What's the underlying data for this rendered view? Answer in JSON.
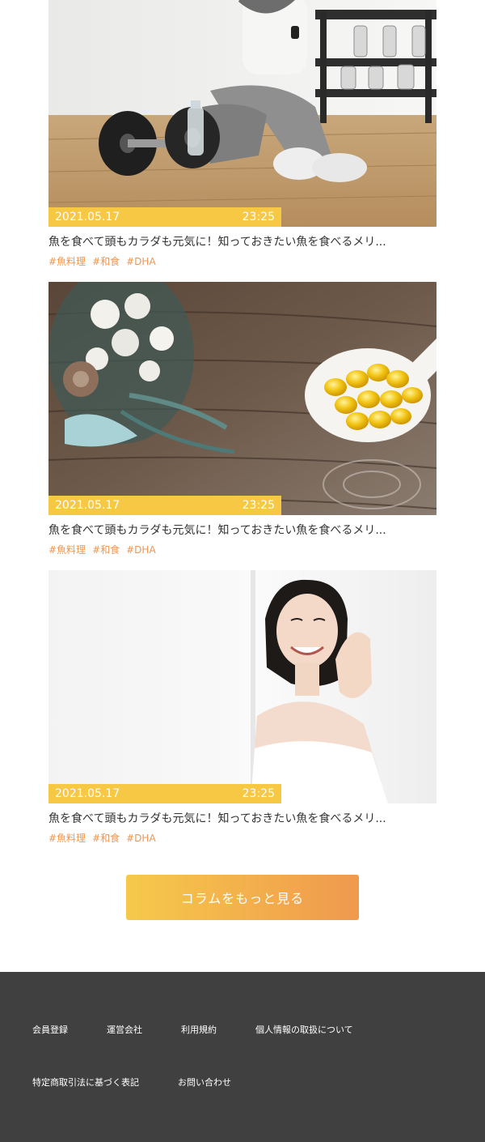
{
  "articles": [
    {
      "date": "2021.05.17",
      "time": "23:25",
      "title": "魚を食べて頭もカラダも元気に！知っておきたい魚を食べるメリ...",
      "tags": [
        "#魚料理",
        "#和食",
        "#DHA"
      ],
      "image": "woman-resting-in-gym-with-dumbbells"
    },
    {
      "date": "2021.05.17",
      "time": "23:25",
      "title": "魚を食べて頭もカラダも元気に！知っておきたい魚を食べるメリ...",
      "tags": [
        "#魚料理",
        "#和食",
        "#DHA"
      ],
      "image": "fish-oil-capsules-on-spoon-with-flowers"
    },
    {
      "date": "2021.05.17",
      "time": "23:25",
      "title": "魚を食べて頭もカラダも元気に！知っておきたい魚を食べるメリ...",
      "tags": [
        "#魚料理",
        "#和食",
        "#DHA"
      ],
      "image": "smiling-woman-portrait"
    }
  ],
  "more_button": {
    "label": "コラムをもっと見る"
  },
  "footer": {
    "links": [
      "会員登録",
      "運営会社",
      "利用規約",
      "個人情報の取扱について",
      "特定商取引法に基づく表記",
      "お問い合わせ"
    ]
  },
  "colors": {
    "meta_bar": "#f6c843",
    "tag": "#f0964f",
    "button_gradient_start": "#f6c94a",
    "button_gradient_end": "#f0994e",
    "footer_bg": "#404040"
  }
}
